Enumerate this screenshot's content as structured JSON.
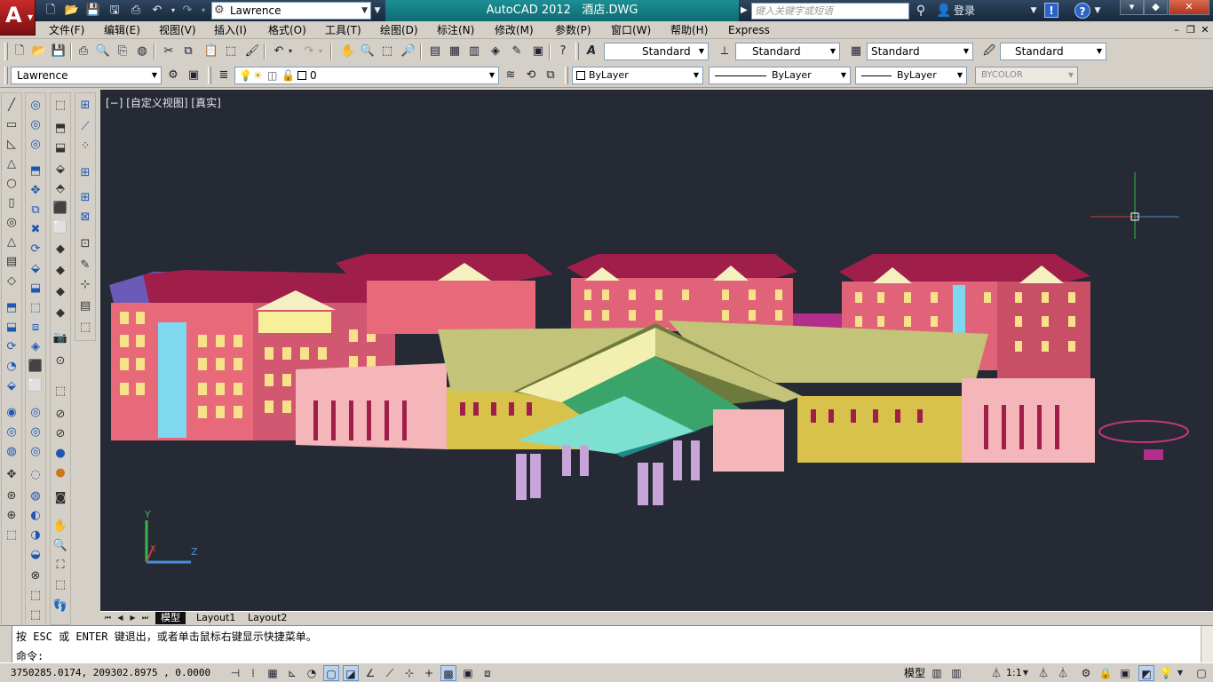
{
  "title_bar": {
    "app_name": "AutoCAD 2012",
    "file_name": "酒店.DWG",
    "workspace": "Lawrence",
    "search_placeholder": "键入关键字或短语",
    "login_label": "登录",
    "info_label": "!",
    "help_label": "?"
  },
  "menu": {
    "items": [
      "文件(F)",
      "编辑(E)",
      "视图(V)",
      "插入(I)",
      "格式(O)",
      "工具(T)",
      "绘图(D)",
      "标注(N)",
      "修改(M)",
      "参数(P)",
      "窗口(W)",
      "帮助(H)",
      "Express"
    ]
  },
  "styles_toolbar": {
    "text_style": "Standard",
    "dim_style": "Standard",
    "table_style": "Standard",
    "mleader_style": "Standard"
  },
  "workspace_toolbar": {
    "workspace": "Lawrence"
  },
  "layers_toolbar": {
    "current_layer": "0"
  },
  "properties_toolbar": {
    "color": "ByLayer",
    "linetype": "ByLayer",
    "lineweight": "ByLayer",
    "plot_style": "BYCOLOR"
  },
  "viewport": {
    "label": "[−] [自定义视图] [真实]",
    "ucs_x": "X",
    "ucs_y": "Y",
    "ucs_z": "Z"
  },
  "tabs": {
    "model": "模型",
    "layout1": "Layout1",
    "layout2": "Layout2"
  },
  "command": {
    "history": "按 ESC 或 ENTER 键退出，或者单击鼠标右键显示快捷菜单。",
    "prompt": "命令:"
  },
  "status_bar": {
    "coordinates": "3750285.0174, 209302.8975 , 0.0000",
    "model_label": "模型",
    "scale": "1:1"
  },
  "colors": {
    "viewport_bg": "#252a35",
    "title_teal": "#1b8f95",
    "app_button": "#c92a2a"
  }
}
